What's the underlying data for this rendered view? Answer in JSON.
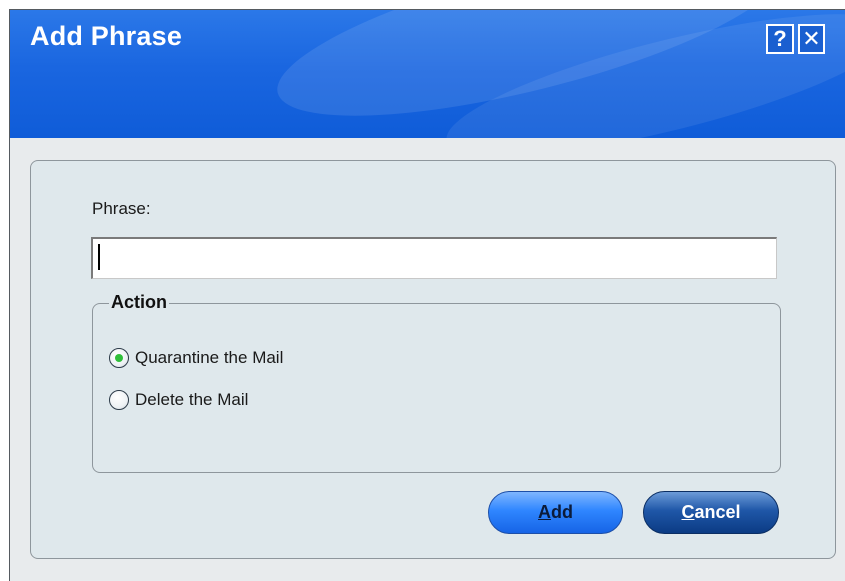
{
  "window": {
    "title": "Add Phrase",
    "help_button_label": "?",
    "close_button_label": "✕"
  },
  "form": {
    "phrase_label": "Phrase:",
    "phrase_value": "",
    "action_group_label": "Action",
    "options": [
      {
        "label": "Quarantine the Mail",
        "selected": true
      },
      {
        "label": "Delete the Mail",
        "selected": false
      }
    ]
  },
  "buttons": {
    "add_mnemonic": "A",
    "add_rest": "dd",
    "cancel_mnemonic": "C",
    "cancel_rest": "ancel"
  },
  "colors": {
    "titlebar": "#1a66e0",
    "content_background": "#dfe8ec",
    "radio_selected_dot": "#2fbf3a",
    "add_button": "#2f86ff",
    "cancel_button": "#0b3b84"
  }
}
